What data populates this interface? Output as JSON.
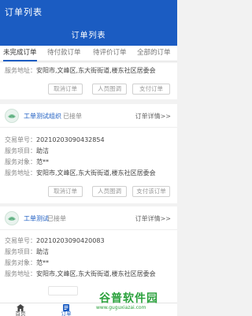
{
  "app": {
    "title": "订单列表"
  },
  "header": {
    "title": "订单列表"
  },
  "tabs": [
    {
      "label": "未完成订单",
      "active": true
    },
    {
      "label": "待付款订单",
      "active": false
    },
    {
      "label": "待评价订单",
      "active": false
    },
    {
      "label": "全部的订单",
      "active": false
    }
  ],
  "orders": [
    {
      "address_label": "服务地址：",
      "address": "安阳市,文峰区,东大街街道,楼东社区居委会",
      "buttons": {
        "cancel": "取消订单",
        "staff": "人员图调",
        "pay": "支付订单"
      }
    },
    {
      "org_name": "工单测试组织",
      "status": "已接单",
      "detail_link": "订单详情>>",
      "number_label": "交易单号：",
      "number": "20210203090432854",
      "type_label": "服务项目：",
      "type": "助洁",
      "target_label": "服务对象：",
      "target": "范**",
      "address_label": "服务地址：",
      "address": "安阳市,文峰区,东大街街道,楼东社区居委会",
      "buttons": {
        "cancel": "取消订单",
        "staff": "人员图调",
        "pay": "支付该订单"
      }
    },
    {
      "org_name": "工单测试",
      "status": "已接单",
      "detail_link": "订单详情>>",
      "number_label": "交易单号：",
      "number": "20210203090420083",
      "type_label": "服务项目：",
      "type": "助洁",
      "target_label": "服务对象：",
      "target": "范**",
      "address_label": "服务地址：",
      "address": "安阳市,文峰区,东大街街道,楼东社区居委会"
    }
  ],
  "bottom_nav": [
    {
      "label": "首页",
      "icon": "home-icon"
    },
    {
      "label": "订单",
      "icon": "order-list-icon",
      "active": true
    }
  ],
  "watermark": {
    "main": "谷普软件园",
    "sub": "www.guguxiazai.com"
  },
  "colors": {
    "primary": "#1b5cc2",
    "background": "#f2f2f2",
    "watermark": "#2aa13c"
  }
}
